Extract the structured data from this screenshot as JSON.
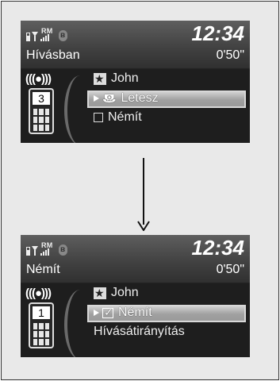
{
  "status": {
    "rm": "RM",
    "bluetooth_icon": "bluetooth-icon"
  },
  "before": {
    "clock": "12:34",
    "call_state": "Hívásban",
    "duration": "0'50\"",
    "phone_number": "3",
    "menu": {
      "contact": "John",
      "selected": "Letesz",
      "option": "Némít"
    }
  },
  "after": {
    "clock": "12:34",
    "call_state": "Némít",
    "duration": "0'50\"",
    "phone_number": "1",
    "menu": {
      "contact": "John",
      "selected": "Némít",
      "option": "Hívásátirányítás"
    }
  },
  "colors": {
    "screen_bg": "#232323",
    "highlight": "#c0c0c0",
    "frame_bg": "#e9e9e9"
  }
}
